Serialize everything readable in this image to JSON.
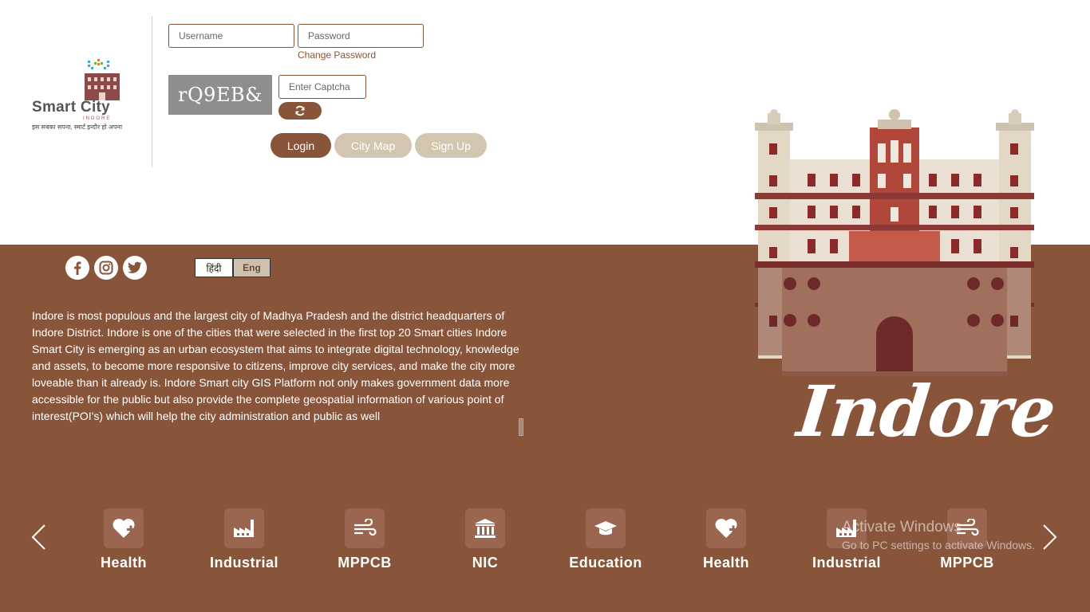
{
  "logo": {
    "brand": "Smart City",
    "city": "INDORE",
    "tagline": "इस सबका सपना, स्मार्ट इन्दौर हो अपना"
  },
  "login_form": {
    "username_placeholder": "Username",
    "password_placeholder": "Password",
    "change_password": "Change Password",
    "captcha_text": "rQ9EB&",
    "captcha_placeholder": "Enter Captcha",
    "refresh_icon": "refresh-icon"
  },
  "buttons": {
    "login": "Login",
    "city_map": "City Map",
    "sign_up": "Sign Up"
  },
  "social": {
    "facebook_icon": "facebook-icon",
    "instagram_icon": "instagram-icon",
    "twitter_icon": "twitter-icon"
  },
  "language": {
    "hindi": "हिंदी",
    "english": "Eng",
    "selected": "Eng"
  },
  "description": "Indore is most populous and the largest city of Madhya Pradesh and the district headquarters of Indore District. Indore is one of the cities that were selected in the first top 20 Smart cities Indore Smart City is emerging as an urban ecosystem that aims to integrate digital technology, knowledge and assets, to become more responsive to citizens, improve city services, and make the city more loveable than it already is. Indore Smart city GIS Platform not only makes government data more accessible for the public but also provide the complete geospatial information of various point of interest(POI's) which will help the city administration and public as well",
  "hero": {
    "city_name": "Indore",
    "illustration": "rajwada-palace-illustration"
  },
  "categories": [
    {
      "label": "Health",
      "icon": "heart-plus-icon"
    },
    {
      "label": "Industrial",
      "icon": "factory-icon"
    },
    {
      "label": "MPPCB",
      "icon": "wind-icon"
    },
    {
      "label": "NIC",
      "icon": "institution-icon"
    },
    {
      "label": "Education",
      "icon": "graduation-cap-icon"
    },
    {
      "label": "Health",
      "icon": "heart-plus-icon"
    },
    {
      "label": "Industrial",
      "icon": "factory-icon"
    },
    {
      "label": "MPPCB",
      "icon": "wind-icon"
    }
  ],
  "carousel": {
    "prev_icon": "chevron-left-icon",
    "next_icon": "chevron-right-icon"
  },
  "watermark": {
    "title": "Activate Windows",
    "subtitle": "Go to PC settings to activate Windows."
  },
  "colors": {
    "brand_brown": "#89553a",
    "button_beige": "#d3c6b1",
    "captcha_gray": "#8e8e8e",
    "palace_red": "#b0473a",
    "palace_cream": "#e9dfd2"
  }
}
